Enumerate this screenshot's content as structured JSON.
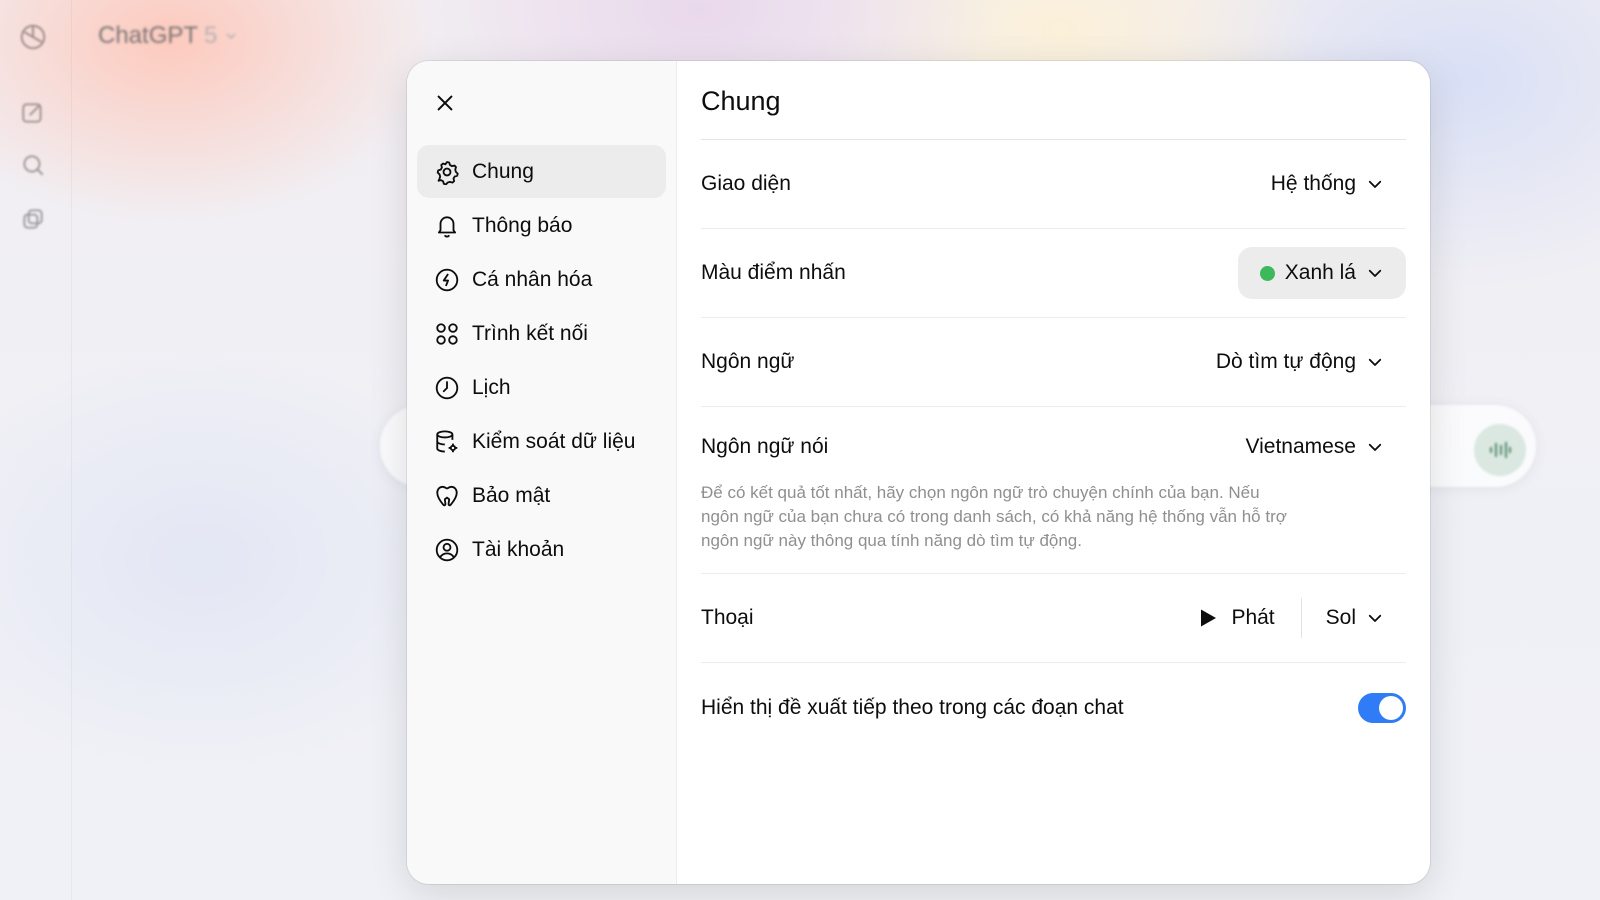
{
  "background": {
    "app_title": "ChatGPT",
    "app_version": "5"
  },
  "modal": {
    "nav": {
      "items": [
        {
          "label": "Chung",
          "icon": "gear-icon",
          "active": true
        },
        {
          "label": "Thông báo",
          "icon": "bell-icon",
          "active": false
        },
        {
          "label": "Cá nhân hóa",
          "icon": "personalize-icon",
          "active": false
        },
        {
          "label": "Trình kết nối",
          "icon": "connectors-icon",
          "active": false
        },
        {
          "label": "Lịch",
          "icon": "clock-icon",
          "active": false
        },
        {
          "label": "Kiểm soát dữ liệu",
          "icon": "database-gear-icon",
          "active": false
        },
        {
          "label": "Bảo mật",
          "icon": "shield-icon",
          "active": false
        },
        {
          "label": "Tài khoản",
          "icon": "user-circle-icon",
          "active": false
        }
      ]
    },
    "content": {
      "title": "Chung",
      "theme": {
        "label": "Giao diện",
        "value": "Hệ thống"
      },
      "accent": {
        "label": "Màu điểm nhấn",
        "value": "Xanh lá",
        "color": "#3db85a"
      },
      "language": {
        "label": "Ngôn ngữ",
        "value": "Dò tìm tự động"
      },
      "spoken_language": {
        "label": "Ngôn ngữ nói",
        "value": "Vietnamese",
        "description": "Để có kết quả tốt nhất, hãy chọn ngôn ngữ trò chuyện chính của bạn. Nếu ngôn ngữ của bạn chưa có trong danh sách, có khả năng hệ thống vẫn hỗ trợ ngôn ngữ này thông qua tính năng dò tìm tự động."
      },
      "voice": {
        "label": "Thoại",
        "play_label": "Phát",
        "value": "Sol"
      },
      "follow_up": {
        "label": "Hiển thị đề xuất tiếp theo trong các đoạn chat",
        "enabled": true
      }
    }
  },
  "colors": {
    "toggle_on": "#2f7cf6",
    "accent_green": "#3db85a"
  }
}
